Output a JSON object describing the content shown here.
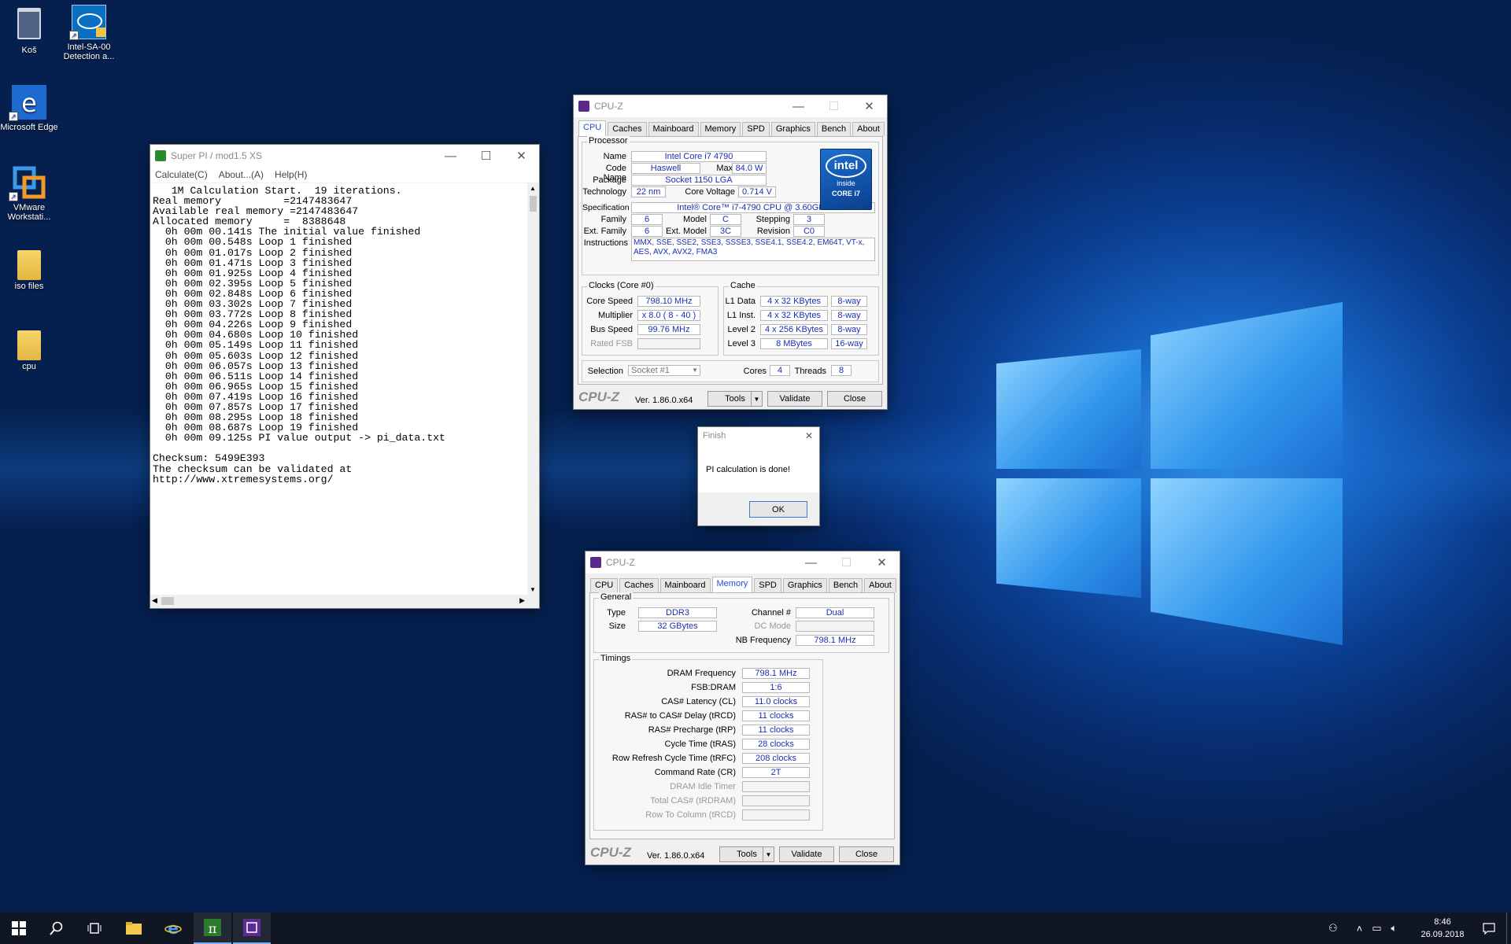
{
  "desktop": {
    "icons": [
      {
        "label": "Koš"
      },
      {
        "label": "Intel-SA-00 Detection a..."
      },
      {
        "label": "Microsoft Edge"
      },
      {
        "label": "VMware Workstati..."
      },
      {
        "label": "iso files"
      },
      {
        "label": "cpu"
      }
    ]
  },
  "superpi": {
    "title": "Super PI / mod1.5 XS",
    "menu": [
      "Calculate(C)",
      "About...(A)",
      "Help(H)"
    ],
    "lines": [
      "   1M Calculation Start.  19 iterations.",
      "Real memory          =2147483647",
      "Available real memory =2147483647",
      "Allocated memory     =  8388648",
      "  0h 00m 00.141s The initial value finished",
      "  0h 00m 00.548s Loop 1 finished",
      "  0h 00m 01.017s Loop 2 finished",
      "  0h 00m 01.471s Loop 3 finished",
      "  0h 00m 01.925s Loop 4 finished",
      "  0h 00m 02.395s Loop 5 finished",
      "  0h 00m 02.848s Loop 6 finished",
      "  0h 00m 03.302s Loop 7 finished",
      "  0h 00m 03.772s Loop 8 finished",
      "  0h 00m 04.226s Loop 9 finished",
      "  0h 00m 04.680s Loop 10 finished",
      "  0h 00m 05.149s Loop 11 finished",
      "  0h 00m 05.603s Loop 12 finished",
      "  0h 00m 06.057s Loop 13 finished",
      "  0h 00m 06.511s Loop 14 finished",
      "  0h 00m 06.965s Loop 15 finished",
      "  0h 00m 07.419s Loop 16 finished",
      "  0h 00m 07.857s Loop 17 finished",
      "  0h 00m 08.295s Loop 18 finished",
      "  0h 00m 08.687s Loop 19 finished",
      "  0h 00m 09.125s PI value output -> pi_data.txt",
      "",
      "Checksum: 5499E393",
      "The checksum can be validated at",
      "http://www.xtremesystems.org/"
    ]
  },
  "cpuz_common": {
    "title": "CPU-Z",
    "tabs": [
      "CPU",
      "Caches",
      "Mainboard",
      "Memory",
      "SPD",
      "Graphics",
      "Bench",
      "About"
    ],
    "brand": "CPU-Z",
    "version": "Ver. 1.86.0.x64",
    "tools": "Tools",
    "validate": "Validate",
    "close": "Close"
  },
  "cpuz_cpu": {
    "processor_label": "Processor",
    "name_l": "Name",
    "name": "Intel Core i7 4790",
    "codename_l": "Code Name",
    "codename": "Haswell",
    "maxtdp_l": "Max TDP",
    "maxtdp": "84.0 W",
    "package_l": "Package",
    "package": "Socket 1150 LGA",
    "tech_l": "Technology",
    "tech": "22 nm",
    "corev_l": "Core Voltage",
    "corev": "0.714 V",
    "spec_l": "Specification",
    "spec": "Intel® Core™ i7-4790 CPU @ 3.60GHz",
    "family_l": "Family",
    "family": "6",
    "model_l": "Model",
    "model": "C",
    "stepping_l": "Stepping",
    "stepping": "3",
    "extfamily_l": "Ext. Family",
    "extfamily": "6",
    "extmodel_l": "Ext. Model",
    "extmodel": "3C",
    "revision_l": "Revision",
    "revision": "C0",
    "instr_l": "Instructions",
    "instr": "MMX, SSE, SSE2, SSE3, SSSE3, SSE4.1, SSE4.2, EM64T, VT-x, AES, AVX, AVX2, FMA3",
    "clocks_label": "Clocks (Core #0)",
    "corespeed_l": "Core Speed",
    "corespeed": "798.10 MHz",
    "mult_l": "Multiplier",
    "mult": "x 8.0 ( 8 - 40 )",
    "bus_l": "Bus Speed",
    "bus": "99.76 MHz",
    "fsb_l": "Rated FSB",
    "cache_label": "Cache",
    "l1d_l": "L1 Data",
    "l1d": "4 x 32 KBytes",
    "l1d_w": "8-way",
    "l1i_l": "L1 Inst.",
    "l1i": "4 x 32 KBytes",
    "l1i_w": "8-way",
    "l2_l": "Level 2",
    "l2": "4 x 256 KBytes",
    "l2_w": "8-way",
    "l3_l": "Level 3",
    "l3": "8 MBytes",
    "l3_w": "16-way",
    "selection_l": "Selection",
    "selection": "Socket #1",
    "cores_l": "Cores",
    "cores": "4",
    "threads_l": "Threads",
    "threads": "8",
    "intel_logo": {
      "brand": "intel",
      "inside": "inside",
      "model": "CORE i7"
    }
  },
  "cpuz_mem": {
    "general_label": "General",
    "type_l": "Type",
    "type": "DDR3",
    "size_l": "Size",
    "size": "32 GBytes",
    "channel_l": "Channel #",
    "channel": "Dual",
    "dcmode_l": "DC Mode",
    "nbfreq_l": "NB Frequency",
    "nbfreq": "798.1 MHz",
    "timings_label": "Timings",
    "timings": [
      {
        "label": "DRAM Frequency",
        "value": "798.1 MHz"
      },
      {
        "label": "FSB:DRAM",
        "value": "1:6"
      },
      {
        "label": "CAS# Latency (CL)",
        "value": "11.0 clocks"
      },
      {
        "label": "RAS# to CAS# Delay (tRCD)",
        "value": "11 clocks"
      },
      {
        "label": "RAS# Precharge (tRP)",
        "value": "11 clocks"
      },
      {
        "label": "Cycle Time (tRAS)",
        "value": "28 clocks"
      },
      {
        "label": "Row Refresh Cycle Time (tRFC)",
        "value": "208 clocks"
      },
      {
        "label": "Command Rate (CR)",
        "value": "2T"
      },
      {
        "label": "DRAM Idle Timer",
        "value": ""
      },
      {
        "label": "Total CAS# (tRDRAM)",
        "value": ""
      },
      {
        "label": "Row To Column (tRCD)",
        "value": ""
      }
    ]
  },
  "finish": {
    "title": "Finish",
    "message": "PI calculation is done!",
    "ok": "OK"
  },
  "taskbar": {
    "time": "8:46",
    "date": "26.09.2018"
  }
}
